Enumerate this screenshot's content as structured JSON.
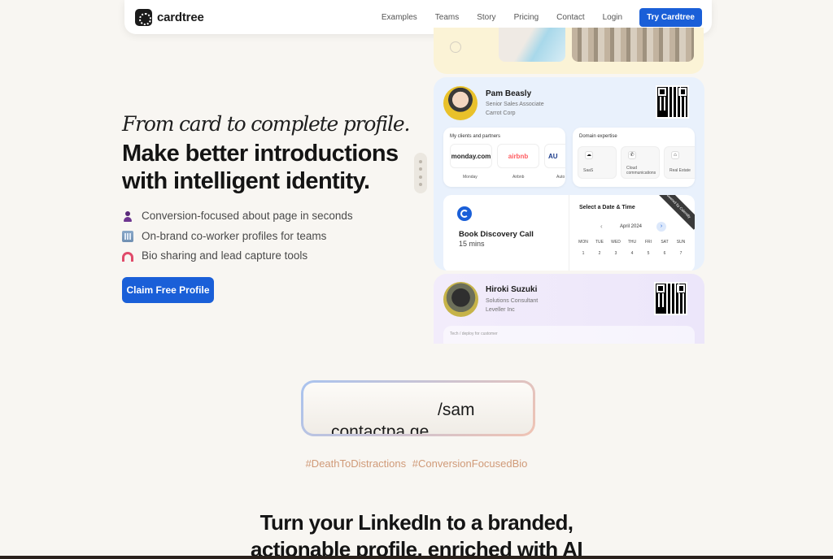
{
  "nav": {
    "brand": "cardtree",
    "links": [
      "Examples",
      "Teams",
      "Story",
      "Pricing",
      "Contact",
      "Login"
    ],
    "cta": "Try Cardtree"
  },
  "hero": {
    "italic_line": "From card to complete profile.",
    "title_line1": "Make better introductions",
    "title_line2": "with intelligent identity.",
    "features": [
      {
        "icon": "person-icon",
        "text": "Conversion-focused about page in seconds"
      },
      {
        "icon": "office-building-icon",
        "text": "On-brand co-worker profiles for teams"
      },
      {
        "icon": "magnet-icon",
        "text": "Bio sharing and lead capture tools"
      }
    ],
    "cta": "Claim Free Profile"
  },
  "pam": {
    "name": "Pam Beasly",
    "role": "Senior Sales Associate",
    "company": "Carrot Corp",
    "clients_title": "My clients and partners",
    "clients": [
      {
        "logo": "monday.com",
        "caption": "Monday",
        "color": "#222222"
      },
      {
        "logo": "airbnb",
        "caption": "Airbnb",
        "color": "#ff5a5f"
      },
      {
        "logo": "AU",
        "caption": "Auto",
        "color": "#1a3a8a"
      }
    ],
    "domain_title": "Domain expertise",
    "domains": [
      {
        "icon": "cloud-icon",
        "caption": "SaaS"
      },
      {
        "icon": "phone-icon",
        "caption": "Cloud communications"
      },
      {
        "icon": "home-icon",
        "caption": "Real Estate"
      }
    ]
  },
  "booking": {
    "title": "Book Discovery Call",
    "duration": "15 mins",
    "picker_title": "Select a Date & Time",
    "month": "April 2024",
    "ribbon": "Powered by Calendly",
    "weekdays": [
      "MON",
      "TUE",
      "WED",
      "THU",
      "FRI",
      "SAT",
      "SUN"
    ],
    "days": [
      "1",
      "2",
      "3",
      "4",
      "5",
      "6",
      "7"
    ]
  },
  "hiroki": {
    "name": "Hiroki Suzuki",
    "role": "Solutions Consultant",
    "company": "Leveller Inc",
    "inner_text": "Tech / deploy for customer"
  },
  "url": {
    "path": "/sam",
    "domain": "contactpa.ge"
  },
  "hashtags": [
    "#DeathToDistractions",
    "#ConversionFocusedBio"
  ],
  "bottom": {
    "line1": "Turn your LinkedIn to a branded,",
    "line2": "actionable profile, enriched with AI"
  },
  "colors": {
    "accent": "#1a5fd8",
    "background": "#f8f6f2",
    "hashtag": "#d09a78"
  }
}
